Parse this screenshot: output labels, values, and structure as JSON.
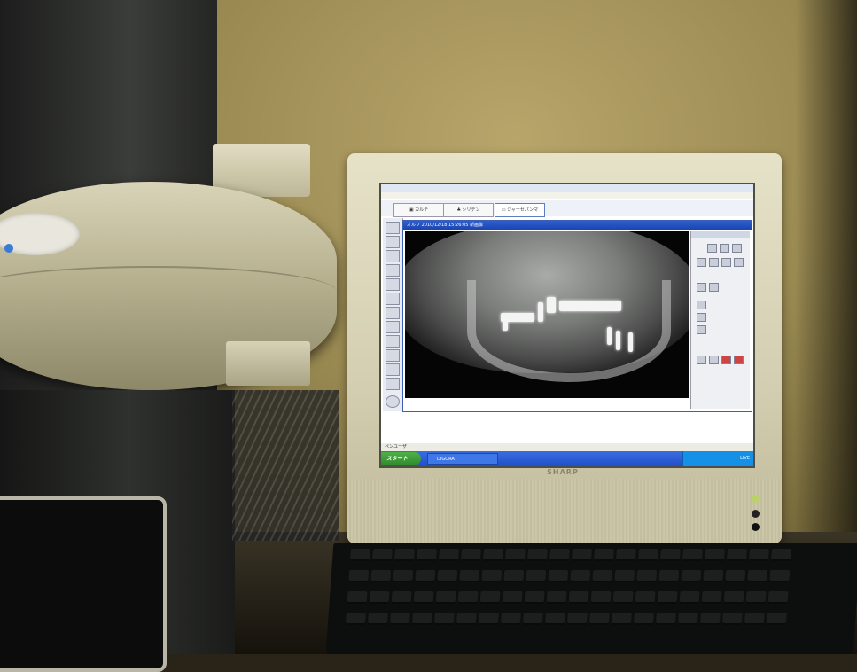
{
  "scene": {
    "monitor_brand": "SHARP",
    "colors": {
      "wall": "#a8975c",
      "monitor_bezel": "#d8d3b7",
      "screen_bg": "#ffffff",
      "taskbar": "#2458d4",
      "xray_bg": "#050505"
    }
  },
  "screen": {
    "app_tabs": [
      {
        "label": "カルテ",
        "icon": "chart-icon"
      },
      {
        "label": "シリデン",
        "icon": "tree-icon"
      },
      {
        "label": "ジャーセパンマ",
        "icon": "xray-icon"
      }
    ],
    "viewer_title": "オルソ 2010/12/18 15:26:05 新画像",
    "status_text": "ペンユーザ",
    "taskbar": {
      "start_label": "スタート",
      "task_label": "DIGORA",
      "tray_text": "LIVE"
    }
  }
}
